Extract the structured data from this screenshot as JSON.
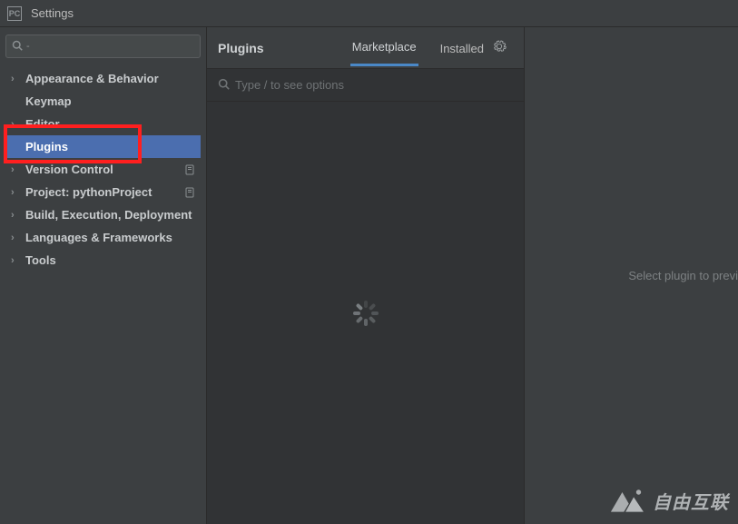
{
  "window": {
    "title": "Settings",
    "app_icon_label": "PC"
  },
  "sidebar": {
    "search_placeholder": "",
    "items": [
      {
        "label": "Appearance & Behavior",
        "expandable": true,
        "badge": false
      },
      {
        "label": "Keymap",
        "expandable": false,
        "badge": false
      },
      {
        "label": "Editor",
        "expandable": true,
        "badge": false
      },
      {
        "label": "Plugins",
        "expandable": false,
        "badge": false,
        "selected": true
      },
      {
        "label": "Version Control",
        "expandable": true,
        "badge": true
      },
      {
        "label": "Project: pythonProject",
        "expandable": true,
        "badge": true
      },
      {
        "label": "Build, Execution, Deployment",
        "expandable": true,
        "badge": false
      },
      {
        "label": "Languages & Frameworks",
        "expandable": true,
        "badge": false
      },
      {
        "label": "Tools",
        "expandable": true,
        "badge": false
      }
    ]
  },
  "content": {
    "title": "Plugins",
    "tabs": [
      {
        "label": "Marketplace",
        "active": true
      },
      {
        "label": "Installed",
        "active": false
      }
    ],
    "gear_icon": "gear-icon",
    "search_placeholder": "Type / to see options",
    "detail_message": "Select plugin to previ"
  },
  "highlight": {
    "target_label": "Plugins",
    "color": "#ff1f1f"
  },
  "watermark_text": "自由互联"
}
